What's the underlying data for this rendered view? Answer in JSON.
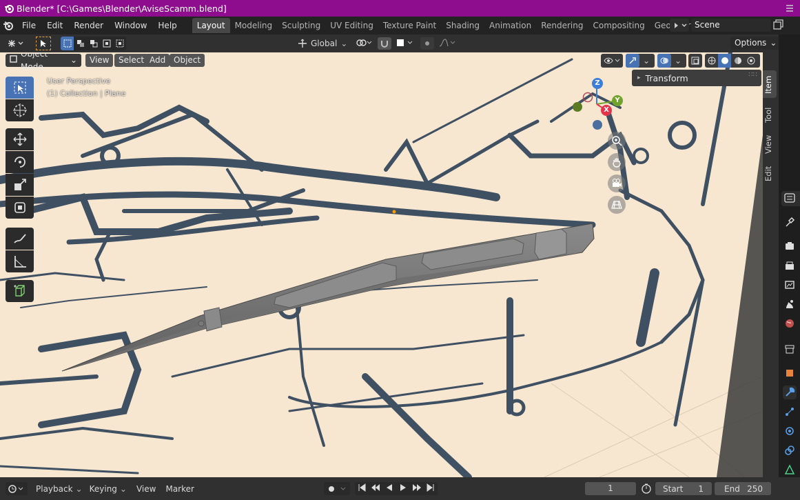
{
  "window": {
    "title": "Blender* [C:\\Games\\Blender\\AviseScamm.blend]"
  },
  "menus": [
    "File",
    "Edit",
    "Render",
    "Window",
    "Help"
  ],
  "workspaces": [
    "Layout",
    "Modeling",
    "Sculpting",
    "UV Editing",
    "Texture Paint",
    "Shading",
    "Animation",
    "Rendering",
    "Compositing",
    "Geometry Nod"
  ],
  "scene": {
    "name": "Scene"
  },
  "toolbar": {
    "orientation": "Global",
    "options_label": "Options"
  },
  "viewport_header": {
    "mode": "Object Mode",
    "view": "View",
    "select": "Select",
    "add": "Add",
    "object": "Object"
  },
  "overlay": {
    "perspective": "User Perspective",
    "collection": "(1) Collection | Plane"
  },
  "gizmo": {
    "z": "Z",
    "y": "Y",
    "x": "X"
  },
  "sidebar": {
    "panel_title": "Transform",
    "tabs": [
      "Item",
      "Tool",
      "View",
      "Edit"
    ]
  },
  "timeline": {
    "playback": "Playback",
    "keying": "Keying",
    "view": "View",
    "marker": "Marker",
    "current_frame": "1",
    "start_label": "Start",
    "start": "1",
    "end_label": "End",
    "end": "250"
  },
  "colors": {
    "title_bar": "#8e0d8e",
    "accent": "#4772b3",
    "sketch_bg": "#f7e7d0",
    "axis_x": "#e3354c",
    "axis_y": "#71a32c",
    "axis_z": "#3b7ed8"
  }
}
